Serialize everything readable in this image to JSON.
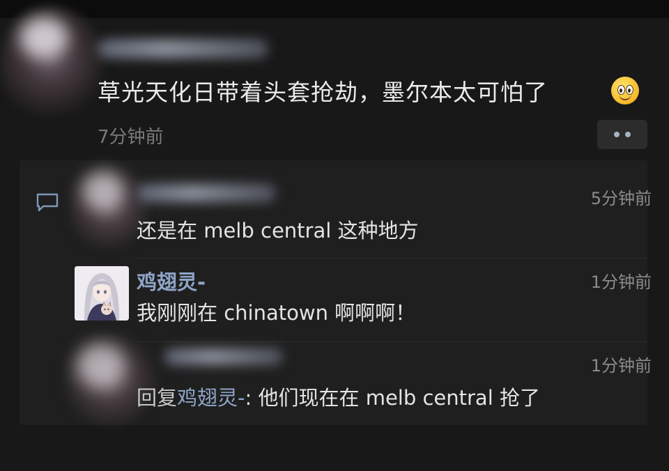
{
  "post": {
    "text": "草光天化日带着头套抢劫，墨尔本太可怕了",
    "emoji": "slightly-smiling-face-emoji",
    "time": "7分钟前"
  },
  "comments": [
    {
      "time": "5分钟前",
      "text": "还是在 melb central 这种地方"
    },
    {
      "name": "鸡翅灵-",
      "time": "1分钟前",
      "text": "我刚刚在 chinatown 啊啊啊！"
    },
    {
      "time": "1分钟前",
      "reply_prefix": "回复",
      "reply_to": "鸡翅灵-",
      "text": ": 他们现在在 melb central 抢了"
    }
  ],
  "icons": {
    "comment": "comment-bubble-icon",
    "more": "more-dots-icon"
  },
  "colors": {
    "background": "#181818",
    "panel": "#1f1f1f",
    "name_link": "#8fa5c8"
  }
}
